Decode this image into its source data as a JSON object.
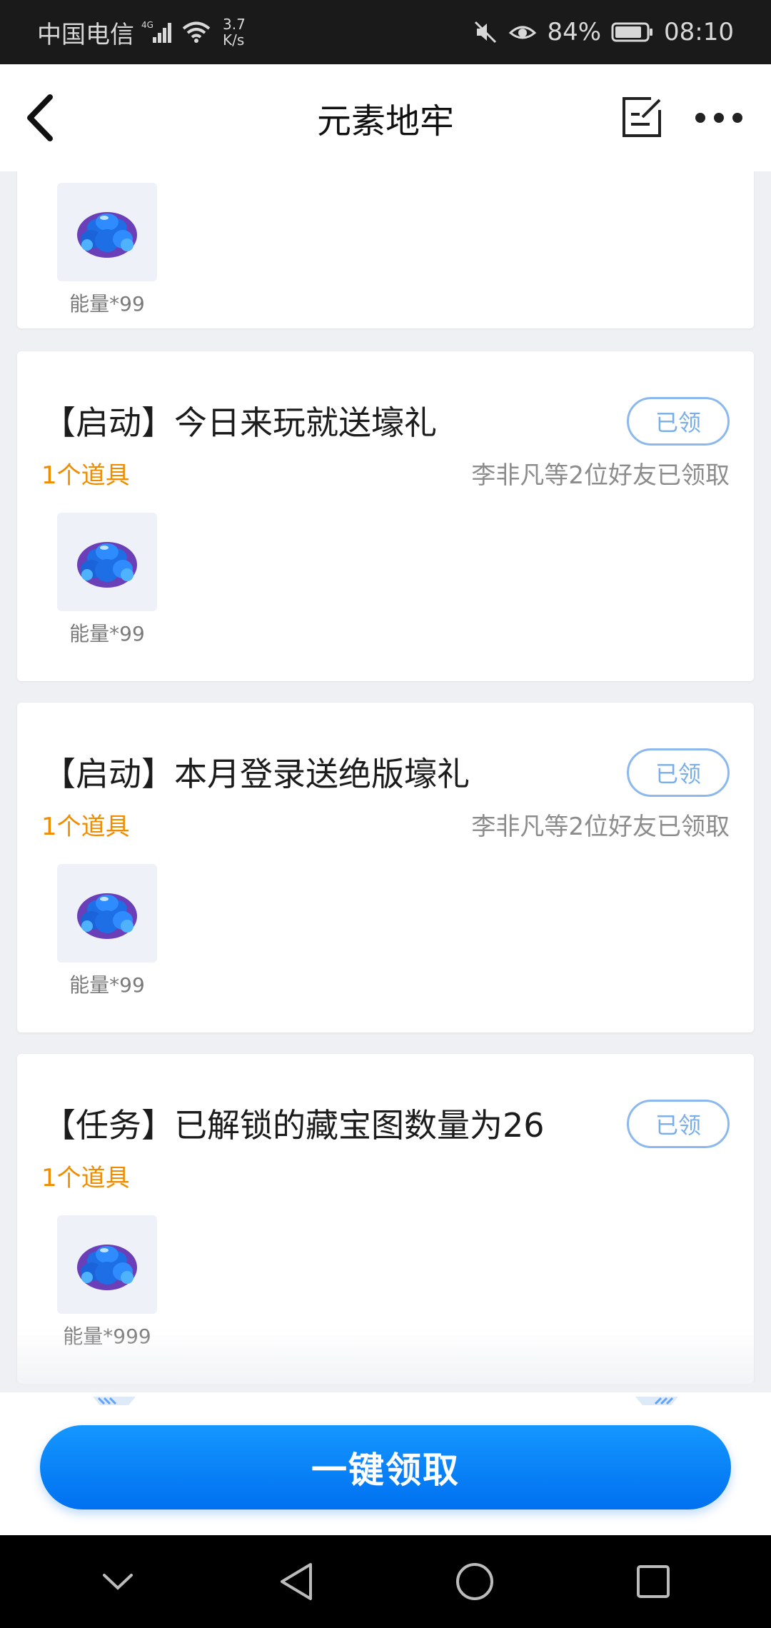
{
  "status_bar": {
    "carrier": "中国电信",
    "network": "4G",
    "speed_value": "3.7",
    "speed_unit": "K/s",
    "battery": "84%",
    "time": "08:10"
  },
  "header": {
    "title": "元素地牢"
  },
  "cards": [
    {
      "title": "",
      "count": "",
      "friends": "",
      "claim_label": "",
      "item_label": "能量*99"
    },
    {
      "title": "【启动】今日来玩就送壕礼",
      "count": "1个道具",
      "friends": "李非凡等2位好友已领取",
      "claim_label": "已领",
      "item_label": "能量*99"
    },
    {
      "title": "【启动】本月登录送绝版壕礼",
      "count": "1个道具",
      "friends": "李非凡等2位好友已领取",
      "claim_label": "已领",
      "item_label": "能量*99"
    },
    {
      "title": "【任务】已解锁的藏宝图数量为26",
      "count": "1个道具",
      "friends": "",
      "claim_label": "已领",
      "item_label": "能量*999"
    }
  ],
  "bottom": {
    "claim_all_label": "一键领取"
  },
  "colors": {
    "accent_blue": "#0a84ff",
    "count_orange": "#f08c00",
    "claimed_outline": "#8ab8ef"
  },
  "icons": {
    "item": "energy-crystal-icon",
    "back": "back-arrow-icon",
    "edit": "edit-icon",
    "more": "more-icon"
  }
}
